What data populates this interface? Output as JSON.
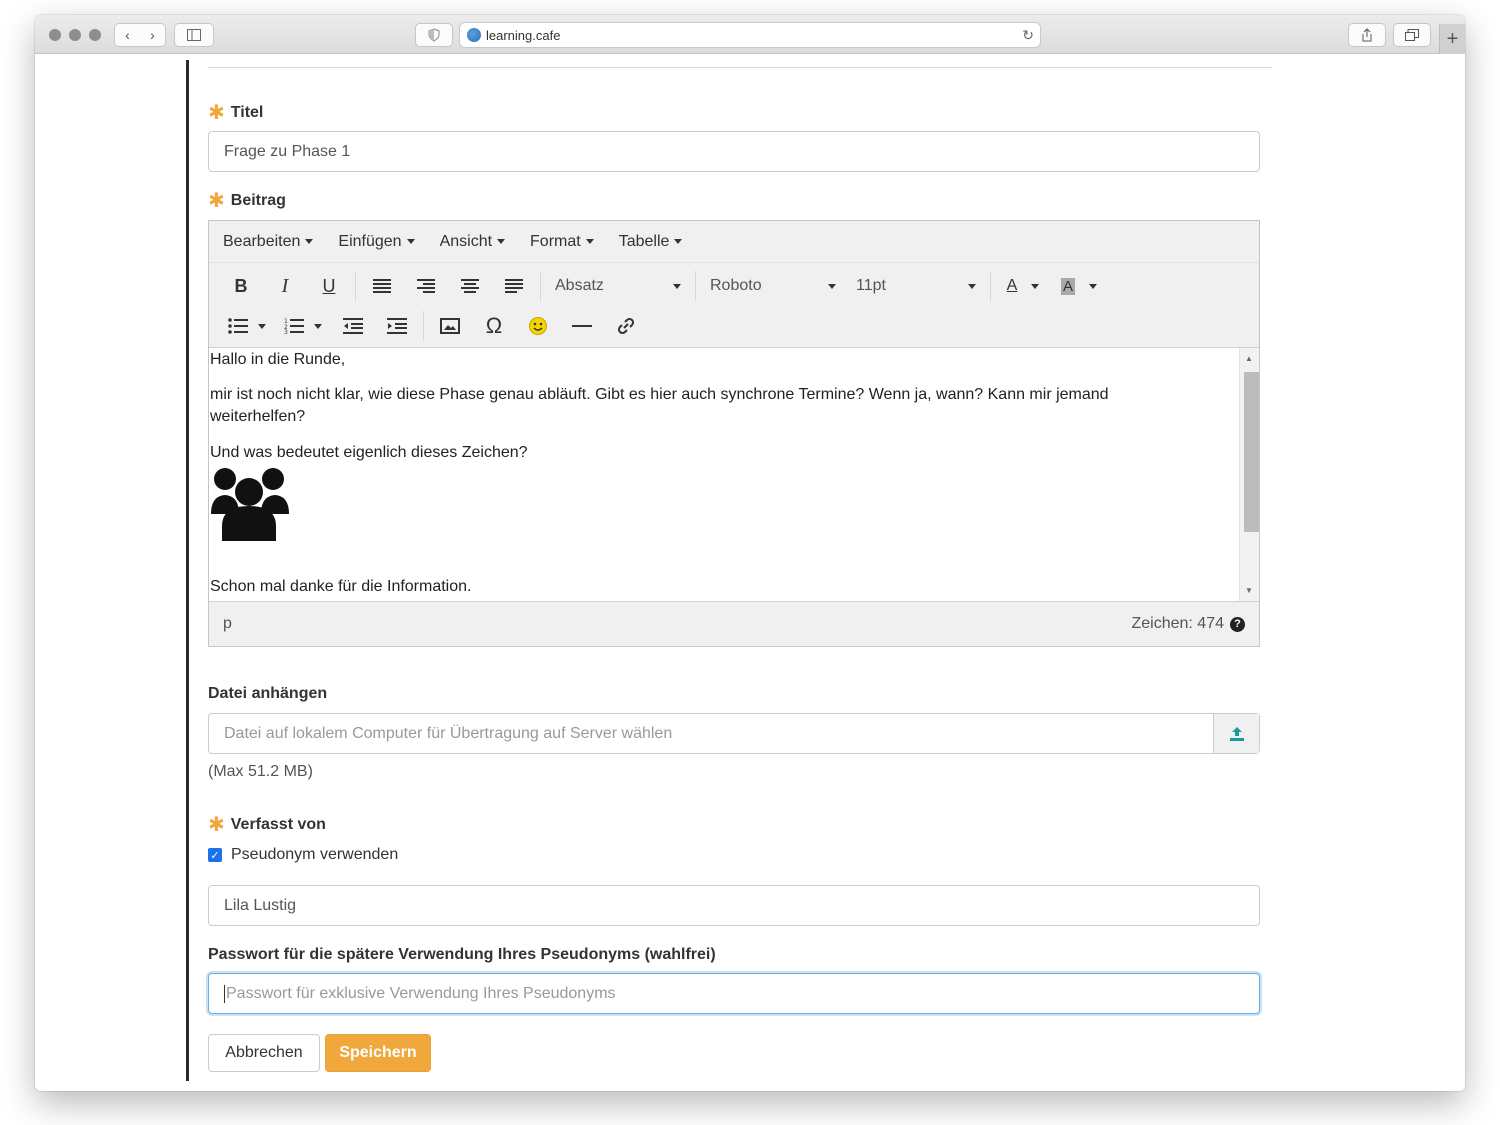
{
  "browser": {
    "url": "learning.cafe"
  },
  "form": {
    "title_label": "Titel",
    "title_value": "Frage zu Phase 1",
    "post_label": "Beitrag",
    "attach_label": "Datei anhängen",
    "attach_placeholder": "Datei auf lokalem Computer für Übertragung auf Server wählen",
    "max_size": "(Max 51.2 MB)",
    "author_label": "Verfasst von",
    "pseudonym_checkbox": "Pseudonym verwenden",
    "pseudonym_value": "Lila Lustig",
    "password_label": "Passwort für die spätere Verwendung Ihres Pseudonyms (wahlfrei)",
    "password_placeholder": "Passwort für exklusive Verwendung Ihres Pseudonyms",
    "cancel_label": "Abbrechen",
    "save_label": "Speichern"
  },
  "editor": {
    "menus": [
      "Bearbeiten",
      "Einfügen",
      "Ansicht",
      "Format",
      "Tabelle"
    ],
    "block_format": "Absatz",
    "font": "Roboto",
    "font_size": "11pt",
    "content": {
      "p1": "Hallo in die Runde,",
      "p2": "mir ist noch nicht klar, wie diese Phase genau abläuft. Gibt es hier auch synchrone Termine? Wenn ja, wann? Kann mir jemand weiterhelfen?",
      "p3": "Und was bedeutet eigenlich dieses Zeichen?",
      "p4": "Schon mal danke für die Information."
    },
    "path": "p",
    "char_count": "Zeichen: 474"
  },
  "colors": {
    "accent": "#f0a83c",
    "checkbox": "#1a73e8",
    "upload_icon": "#1a9a9a"
  }
}
